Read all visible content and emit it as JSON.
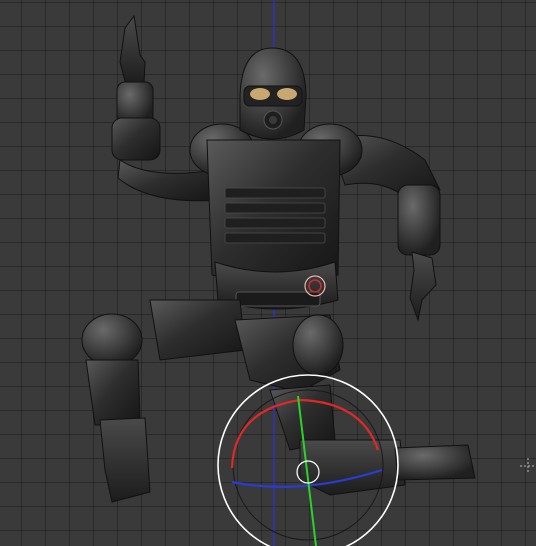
{
  "scene": {
    "object": "armored-soldier-model",
    "mode": "pose",
    "background_color": "#3a3a3a",
    "grid_color": "#2f2f2f"
  },
  "axes": {
    "y_axis_color": "#2f2fd8",
    "x_axis_color": "#d83030"
  },
  "gizmo": {
    "type": "rotate",
    "x_ring_color": "#e02828",
    "y_ring_color": "#2a3cd8",
    "z_ring_color": "#2ad22a",
    "outer_ring_color": "#ffffff",
    "icons": [
      "rotate-gizmo-icon",
      "3d-cursor-icon"
    ]
  },
  "text": {
    "status": ""
  }
}
